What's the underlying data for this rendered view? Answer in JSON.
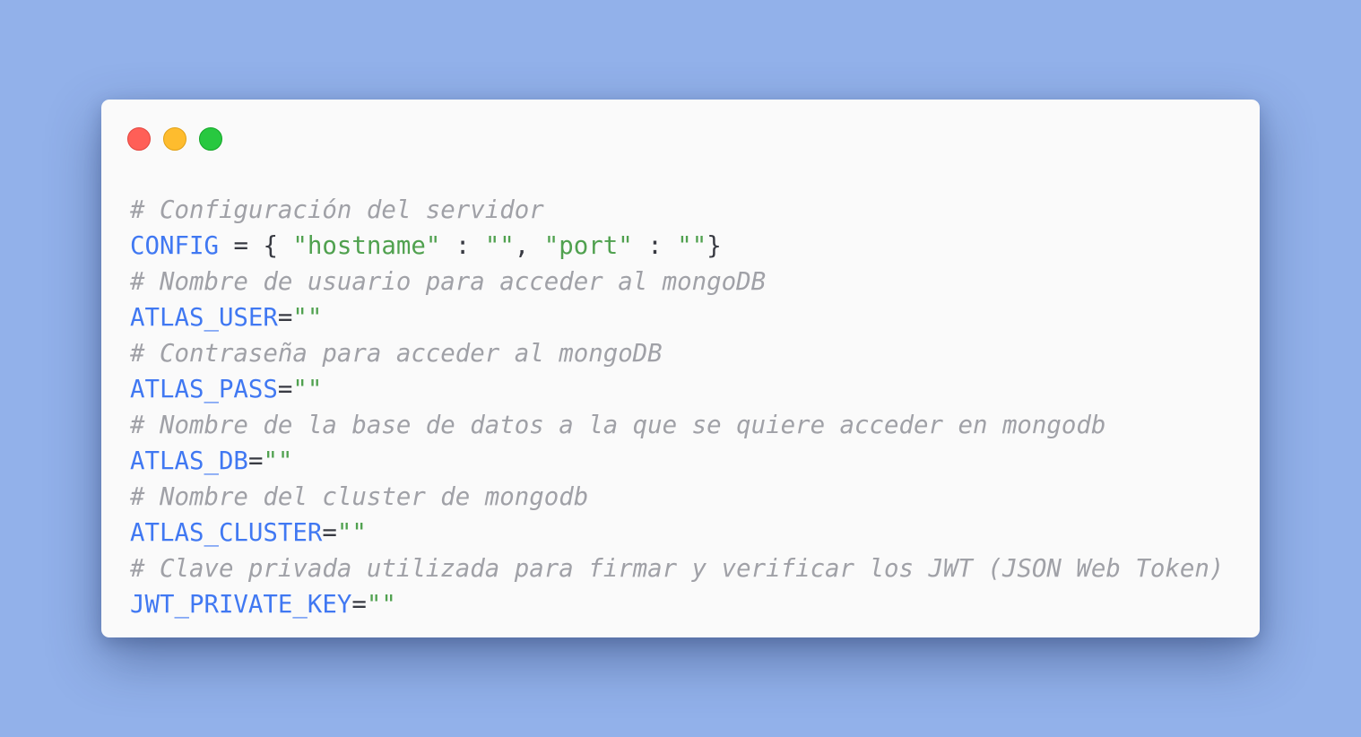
{
  "window": {
    "controls": [
      {
        "name": "close",
        "color": "#ff5f57"
      },
      {
        "name": "minimize",
        "color": "#febc2e"
      },
      {
        "name": "maximize",
        "color": "#28c840"
      }
    ]
  },
  "code": {
    "colors": {
      "comment": "#a0a1a7",
      "variable": "#4078f2",
      "string": "#50a14f",
      "operator": "#383a42"
    },
    "lines": [
      {
        "comment": "# Configuración del servidor"
      },
      {
        "var": "CONFIG",
        "op1": " = ",
        "brace_open": "{ ",
        "key1": "\"hostname\"",
        "colon1": " : ",
        "val1": "\"\"",
        "comma": ", ",
        "key2": "\"port\"",
        "colon2": " : ",
        "val2": "\"\"",
        "brace_close": "}"
      },
      {
        "comment": "# Nombre de usuario para acceder al mongoDB"
      },
      {
        "var": "ATLAS_USER",
        "op": "=",
        "val": "\"\""
      },
      {
        "comment": "# Contraseña para acceder al mongoDB"
      },
      {
        "var": "ATLAS_PASS",
        "op": "=",
        "val": "\"\""
      },
      {
        "comment": "# Nombre de la base de datos a la que se quiere acceder en mongodb"
      },
      {
        "var": "ATLAS_DB",
        "op": "=",
        "val": "\"\""
      },
      {
        "comment": "# Nombre del cluster de mongodb"
      },
      {
        "var": "ATLAS_CLUSTER",
        "op": "=",
        "val": "\"\""
      },
      {
        "comment": "# Clave privada utilizada para firmar y verificar los JWT (JSON Web Token)"
      },
      {
        "var": "JWT_PRIVATE_KEY",
        "op": "=",
        "val": "\"\""
      }
    ]
  }
}
